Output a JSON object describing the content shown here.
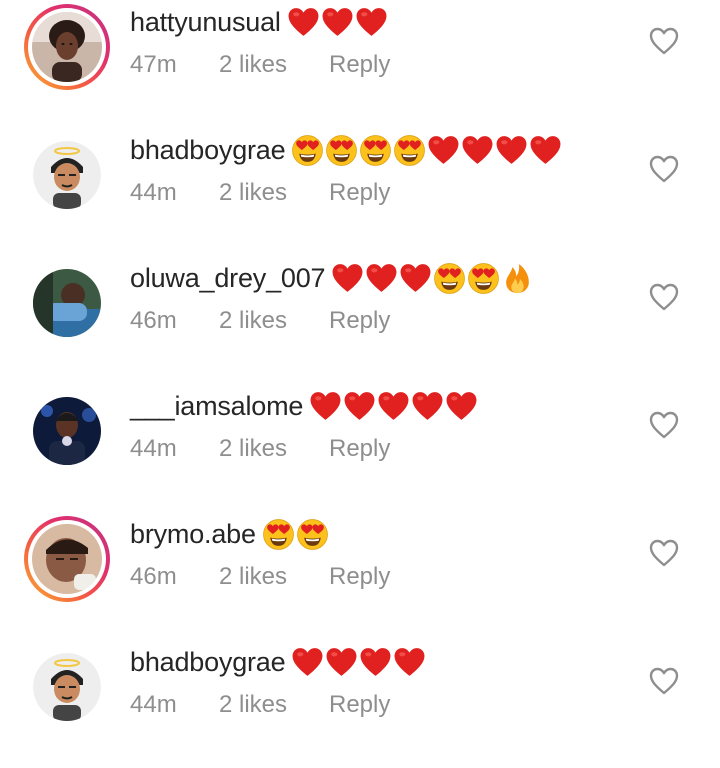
{
  "comments": [
    {
      "username": "hattyunusual",
      "text": "❤❤❤",
      "emojis": [
        "heart-emoji",
        "heart-emoji",
        "heart-emoji"
      ],
      "time": "47m",
      "likes": "2 likes",
      "reply": "Reply",
      "story_ring": true
    },
    {
      "username": "bhadboygrae",
      "text": "😍😍😍😍❤❤❤❤",
      "emojis": [
        "heart-eyes-emoji",
        "heart-eyes-emoji",
        "heart-eyes-emoji",
        "heart-eyes-emoji",
        "heart-emoji",
        "heart-emoji",
        "heart-emoji",
        "heart-emoji"
      ],
      "time": "44m",
      "likes": "2 likes",
      "reply": "Reply",
      "story_ring": false
    },
    {
      "username": "oluwa_drey_007",
      "text": "❤❤❤😍😍🔥",
      "emojis": [
        "heart-emoji",
        "heart-emoji",
        "heart-emoji",
        "heart-eyes-emoji",
        "heart-eyes-emoji",
        "fire-emoji"
      ],
      "time": "46m",
      "likes": "2 likes",
      "reply": "Reply",
      "story_ring": false
    },
    {
      "username": "___iamsalome",
      "text": "❤❤❤❤❤",
      "emojis": [
        "heart-emoji",
        "heart-emoji",
        "heart-emoji",
        "heart-emoji",
        "heart-emoji"
      ],
      "time": "44m",
      "likes": "2 likes",
      "reply": "Reply",
      "story_ring": false
    },
    {
      "username": "brymo.abe",
      "text": "😍😍",
      "emojis": [
        "heart-eyes-emoji",
        "heart-eyes-emoji"
      ],
      "time": "46m",
      "likes": "2 likes",
      "reply": "Reply",
      "story_ring": true
    },
    {
      "username": "bhadboygrae",
      "text": "❤❤❤❤",
      "emojis": [
        "heart-emoji",
        "heart-emoji",
        "heart-emoji",
        "heart-emoji"
      ],
      "time": "44m",
      "likes": "2 likes",
      "reply": "Reply",
      "story_ring": false
    }
  ],
  "colors": {
    "username": "#262626",
    "meta": "#8e8e8e",
    "like_icon": "#8e8e8e",
    "heart_emoji": "#e0211f",
    "story_ring_gradient": [
      "#f9b233",
      "#f56040",
      "#e1306c",
      "#c13584"
    ]
  },
  "icons": {
    "like": "heart-outline-icon"
  }
}
